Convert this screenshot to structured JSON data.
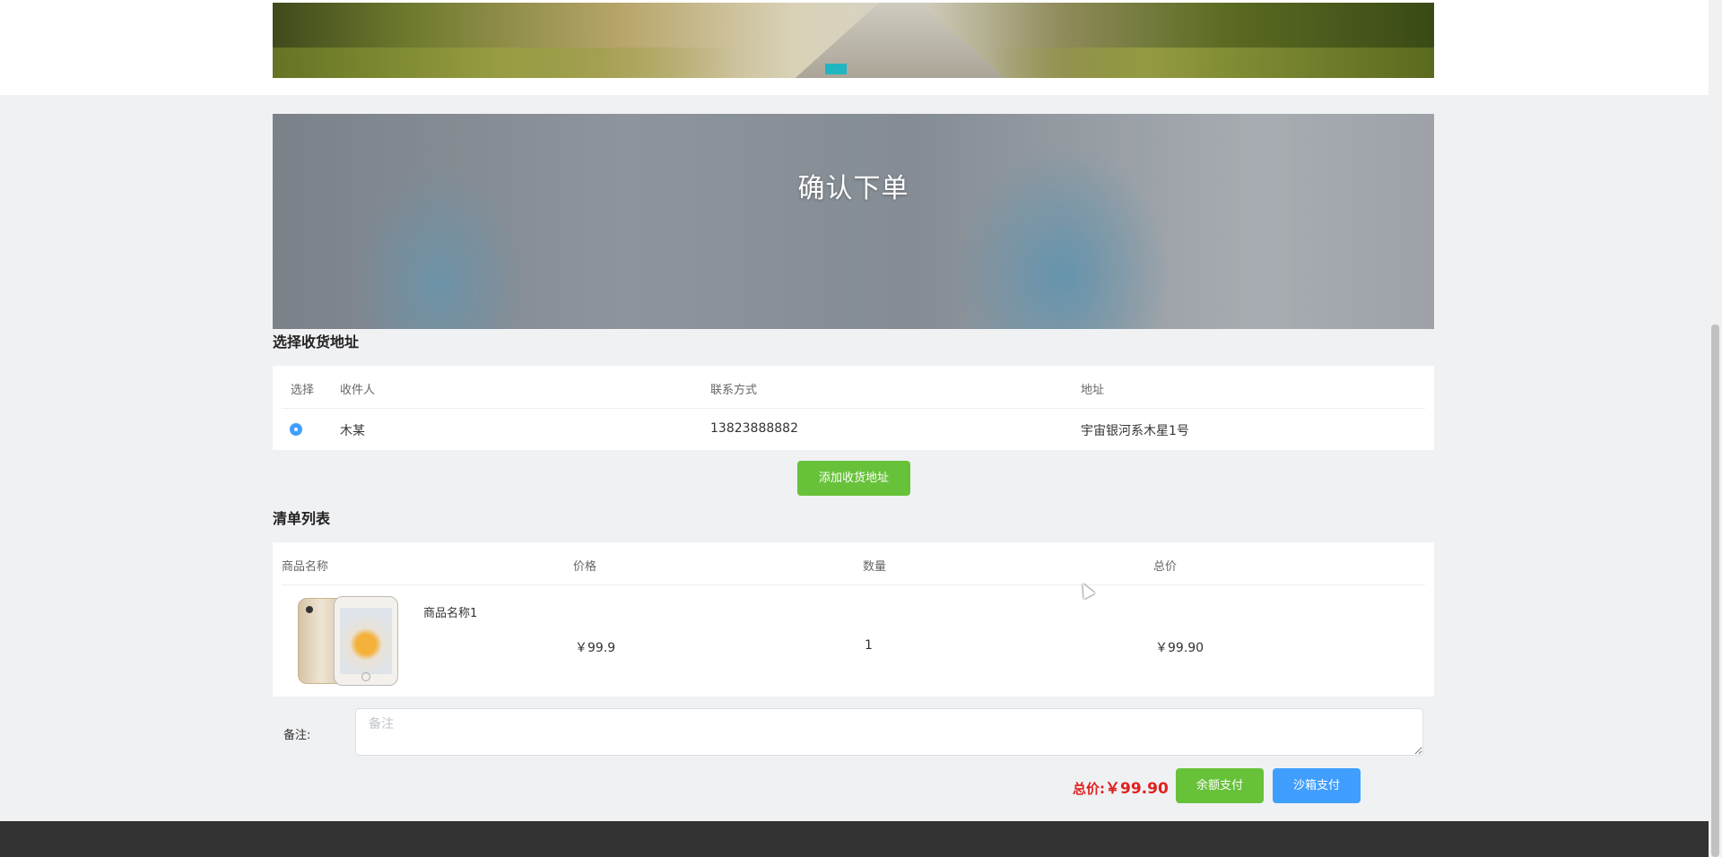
{
  "banner": {
    "title": "确认下单"
  },
  "address_section": {
    "title": "选择收货地址",
    "columns": [
      "选择",
      "收件人",
      "联系方式",
      "地址"
    ],
    "rows": [
      {
        "selected": true,
        "recipient": "木某",
        "phone": "13823888882",
        "address": "宇宙银河系木星1号"
      }
    ],
    "add_button": "添加收货地址"
  },
  "order_section": {
    "title": "清单列表",
    "columns": [
      "商品名称",
      "价格",
      "数量",
      "总价"
    ],
    "items": [
      {
        "name": "商品名称1",
        "price": "￥99.9",
        "quantity": "1",
        "total": "￥99.90"
      }
    ]
  },
  "remark": {
    "label": "备注:",
    "placeholder": "备注"
  },
  "summary": {
    "label": "总价:",
    "amount": "￥99.90",
    "balance_pay": "余额支付",
    "sandbox_pay": "沙箱支付"
  },
  "colors": {
    "primary_green": "#67c23a",
    "primary_blue": "#409eff",
    "price_red": "#e0201e",
    "carousel_indicator": "#1fb5c1"
  }
}
